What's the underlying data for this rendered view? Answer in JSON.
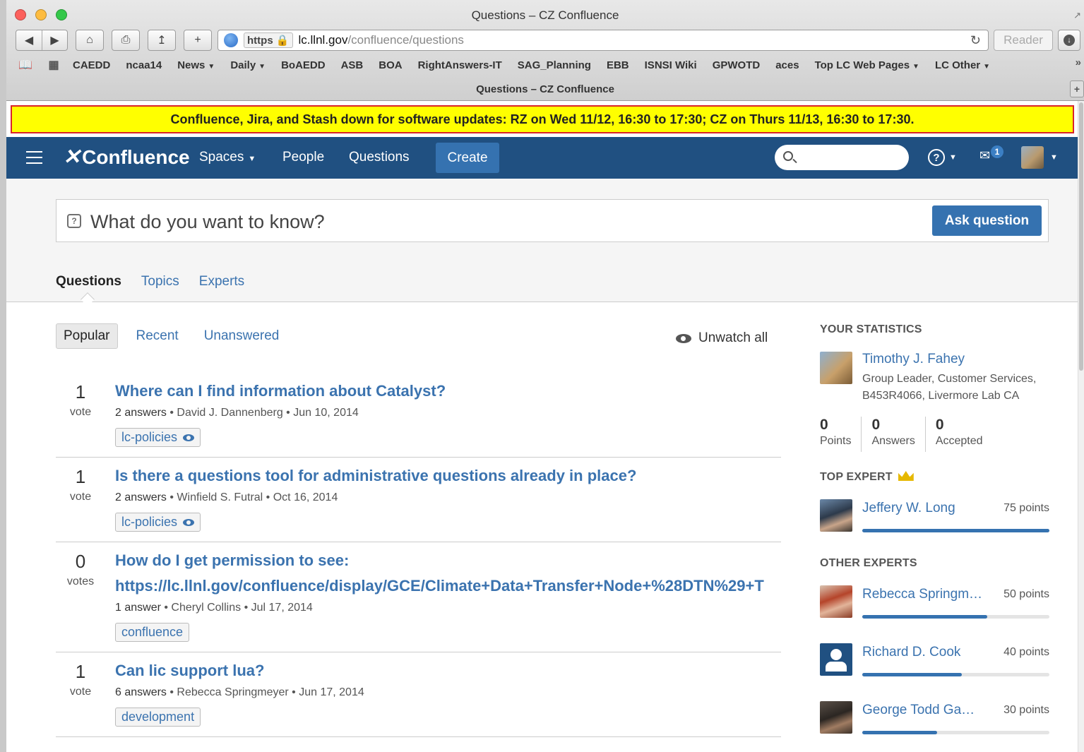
{
  "window": {
    "title": "Questions – CZ Confluence"
  },
  "browser": {
    "url_scheme": "https",
    "url_host": "lc.llnl.gov",
    "url_path": "/confluence/questions",
    "reader_label": "Reader",
    "bookmarks": [
      {
        "label": "CAEDD",
        "menu": false
      },
      {
        "label": "ncaa14",
        "menu": false
      },
      {
        "label": "News",
        "menu": true
      },
      {
        "label": "Daily",
        "menu": true
      },
      {
        "label": "BoAEDD",
        "menu": false
      },
      {
        "label": "ASB",
        "menu": false
      },
      {
        "label": "BOA",
        "menu": false
      },
      {
        "label": "RightAnswers-IT",
        "menu": false
      },
      {
        "label": "SAG_Planning",
        "menu": false
      },
      {
        "label": "EBB",
        "menu": false
      },
      {
        "label": "ISNSI Wiki",
        "menu": false
      },
      {
        "label": "GPWOTD",
        "menu": false
      },
      {
        "label": "aces",
        "menu": false
      },
      {
        "label": "Top LC Web Pages",
        "menu": true
      },
      {
        "label": "LC Other",
        "menu": true
      }
    ],
    "tab_title": "Questions – CZ Confluence"
  },
  "banner": {
    "text": "Confluence, Jira, and Stash down for software updates: RZ on Wed 11/12, 16:30 to 17:30; CZ on Thurs 11/13, 16:30 to 17:30."
  },
  "nav": {
    "logo": "Confluence",
    "spaces": "Spaces",
    "people": "People",
    "questions": "Questions",
    "create": "Create",
    "notification_count": "1",
    "brand_color": "#205081",
    "button_color": "#3572b0"
  },
  "ask": {
    "placeholder": "What do you want to know?",
    "button": "Ask question"
  },
  "tabs": [
    {
      "label": "Questions",
      "active": true
    },
    {
      "label": "Topics",
      "active": false
    },
    {
      "label": "Experts",
      "active": false
    }
  ],
  "filters": [
    {
      "label": "Popular",
      "active": true
    },
    {
      "label": "Recent",
      "active": false
    },
    {
      "label": "Unanswered",
      "active": false
    }
  ],
  "unwatch": "Unwatch all",
  "questions": [
    {
      "votes": "1",
      "vote_label": "vote",
      "title": "Where can I find information about Catalyst?",
      "title2": "",
      "answers": "2 answers",
      "author": "David J. Dannenberg",
      "date": "Jun 10, 2014",
      "tag": "lc-policies",
      "watched": true
    },
    {
      "votes": "1",
      "vote_label": "vote",
      "title": "Is there a questions tool for administrative questions already in place?",
      "title2": "",
      "answers": "2 answers",
      "author": "Winfield S. Futral",
      "date": "Oct 16, 2014",
      "tag": "lc-policies",
      "watched": true
    },
    {
      "votes": "0",
      "vote_label": "votes",
      "title": "How do I get permission to see:",
      "title2": "https://lc.llnl.gov/confluence/display/GCE/Climate+Data+Transfer+Node+%28DTN%29+T",
      "answers": "1 answer",
      "author": "Cheryl Collins",
      "date": "Jul 17, 2014",
      "tag": "confluence",
      "watched": false
    },
    {
      "votes": "1",
      "vote_label": "vote",
      "title": "Can lic support lua?",
      "title2": "",
      "answers": "6 answers",
      "author": "Rebecca Springmeyer",
      "date": "Jun 17, 2014",
      "tag": "development",
      "watched": false
    }
  ],
  "sidebar": {
    "stats_heading": "YOUR STATISTICS",
    "me": {
      "name": "Timothy J. Fahey",
      "role": "Group Leader, Customer Services, B453R4066, Livermore Lab CA"
    },
    "stats": [
      {
        "value": "0",
        "label": "Points"
      },
      {
        "value": "0",
        "label": "Answers"
      },
      {
        "value": "0",
        "label": "Accepted"
      }
    ],
    "top_heading": "TOP EXPERT",
    "top_expert": {
      "name": "Jeffery W. Long",
      "points": "75 points",
      "fill": 1.0
    },
    "other_heading": "OTHER EXPERTS",
    "others": [
      {
        "name": "Rebecca Springm…",
        "points": "50 points",
        "fill": 0.667,
        "avatar": "photo-red"
      },
      {
        "name": "Richard D. Cook",
        "points": "40 points",
        "fill": 0.533,
        "avatar": "default"
      },
      {
        "name": "George Todd Ga…",
        "points": "30 points",
        "fill": 0.4,
        "avatar": "photo-dark"
      }
    ]
  }
}
